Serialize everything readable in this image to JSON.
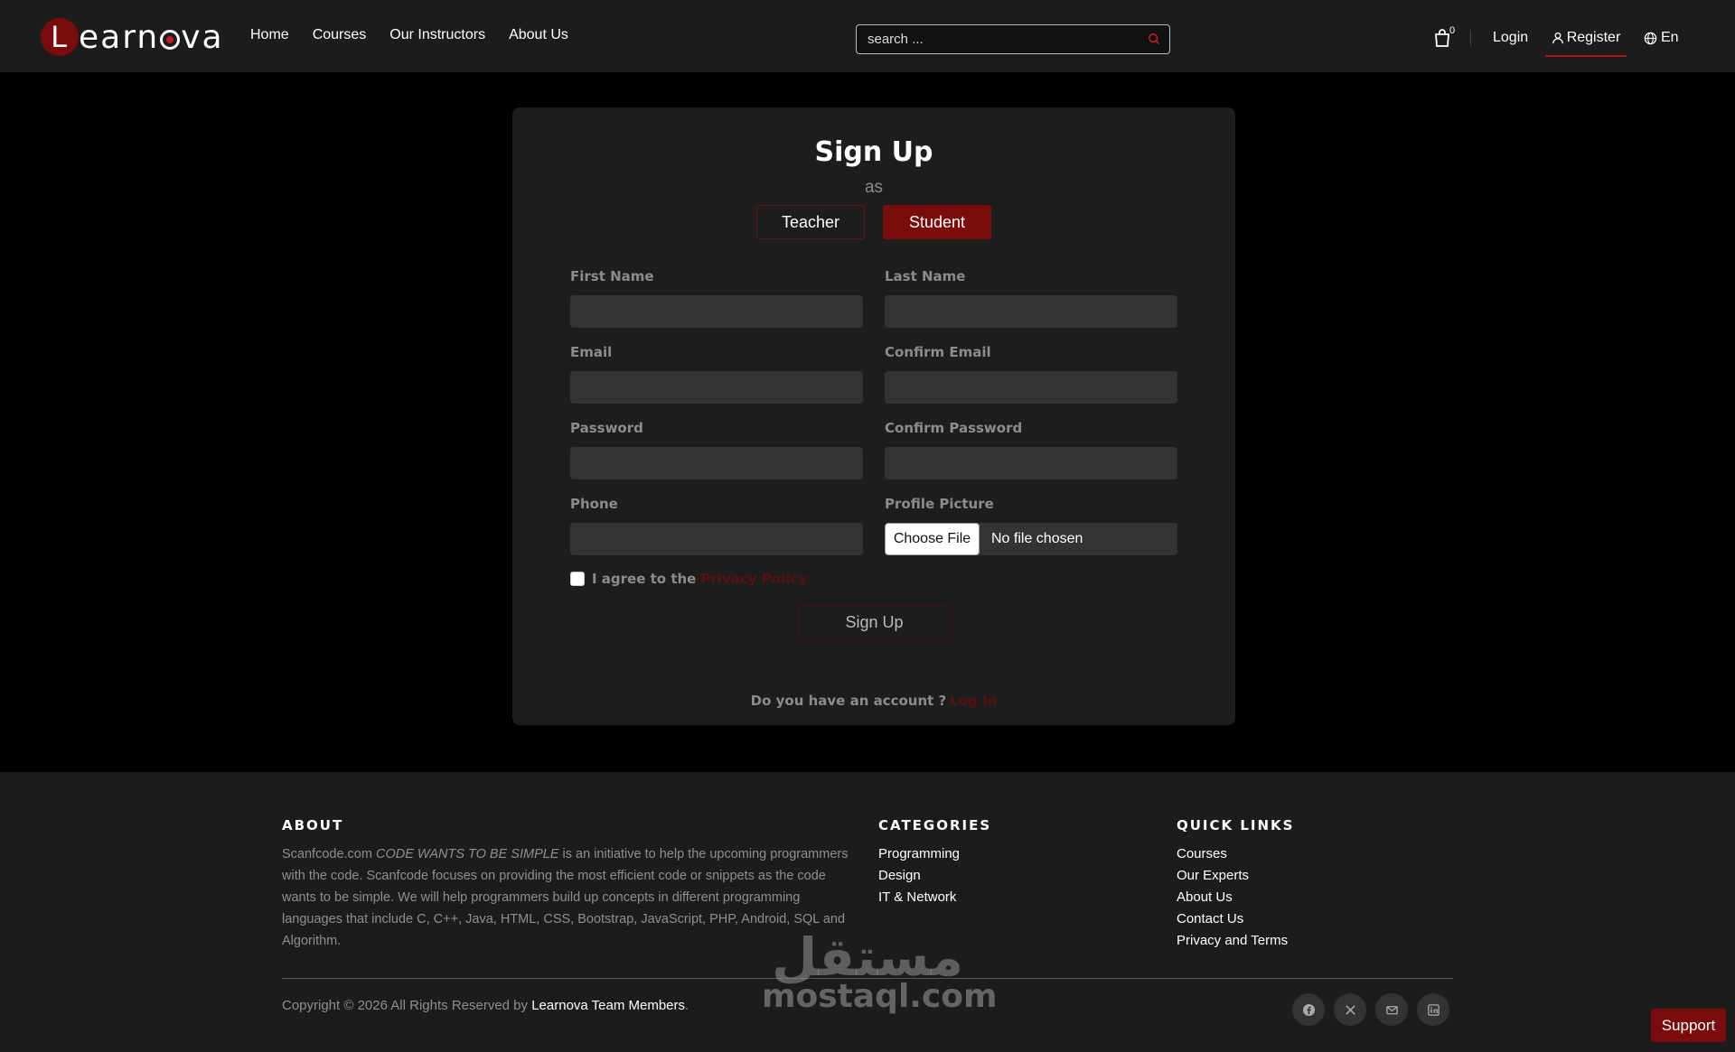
{
  "navbar": {
    "logo_text": "earn",
    "logo_letter": "L",
    "logo_tail": "va",
    "links": [
      "Home",
      "Courses",
      "Our Instructors",
      "About Us"
    ],
    "search_placeholder": "search ...",
    "cart_count": "0",
    "login": "Login",
    "register": "Register",
    "language": "En"
  },
  "signup": {
    "title": "Sign Up",
    "as": "as",
    "roles": [
      "Teacher",
      "Student"
    ],
    "selected_role": "Student",
    "fields": {
      "first_name": "First Name",
      "last_name": "Last Name",
      "email": "Email",
      "confirm_email": "Confirm Email",
      "password": "Password",
      "confirm_password": "Confirm Password",
      "phone": "Phone",
      "profile_picture": "Profile Picture"
    },
    "file_button": "Choose File",
    "file_status": "No file chosen",
    "agree_text": "I agree to the",
    "agree_link": "Privacy Policy",
    "submit": "Sign Up",
    "account_text": "Do you have an account ?",
    "account_link": "Log In"
  },
  "footer": {
    "about_heading": "ABOUT",
    "about_site": "Scanfcode.com",
    "about_slogan": "CODE WANTS TO BE SIMPLE",
    "about_body": "is an initiative to help the upcoming programmers with the code. Scanfcode focuses on providing the most efficient code or snippets as the code wants to be simple. We will help programmers build up concepts in different programming languages that include C, C++, Java, HTML, CSS, Bootstrap, JavaScript, PHP, Android, SQL and Algorithm.",
    "categories_heading": "CATEGORIES",
    "categories": [
      "Programming",
      "Design",
      "IT & Network"
    ],
    "quick_links_heading": "QUICK LINKS",
    "quick_links": [
      "Courses",
      "Our Experts",
      "About Us",
      "Contact Us",
      "Privacy and Terms"
    ],
    "copyright_text": "Copyright © 2026 All Rights Reserved by",
    "copyright_link": "Learnova Team Members",
    "copyright_end": ".",
    "socials": [
      "facebook-icon",
      "x-icon",
      "mail-icon",
      "linkedin-icon"
    ]
  },
  "watermark": {
    "arabic": "مستقل",
    "latin": "mostaql.com"
  },
  "support": "Support",
  "colors": {
    "accent": "#7a0c0c",
    "link_dim": "#5a1010",
    "card": "#1d1d1d",
    "nav": "#1c1c1c"
  }
}
